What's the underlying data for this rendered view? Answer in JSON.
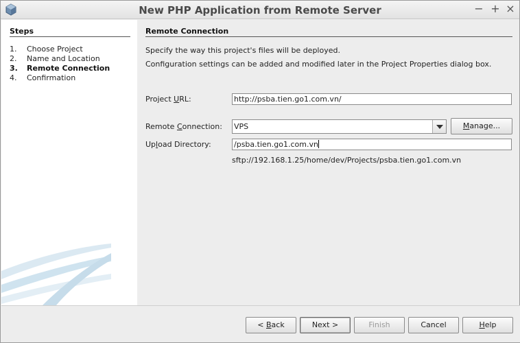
{
  "window": {
    "title": "New PHP Application from Remote Server",
    "minimize_glyph": "−",
    "maximize_glyph": "+",
    "close_glyph": "×"
  },
  "steps": {
    "title": "Steps",
    "items": [
      {
        "num": "1.",
        "label": "Choose Project",
        "current": false
      },
      {
        "num": "2.",
        "label": "Name and Location",
        "current": false
      },
      {
        "num": "3.",
        "label": "Remote Connection",
        "current": true
      },
      {
        "num": "4.",
        "label": "Confirmation",
        "current": false
      }
    ]
  },
  "panel": {
    "title": "Remote Connection",
    "description_1": "Specify the way this project's files will be deployed.",
    "description_2": "Configuration settings can be added and modified later in the Project Properties dialog box."
  },
  "form": {
    "project_url": {
      "label_pre": "Project ",
      "label_mn": "U",
      "label_post": "RL:",
      "value": "http://psba.tien.go1.com.vn/"
    },
    "remote_connection": {
      "label_pre": "Remote ",
      "label_mn": "C",
      "label_post": "onnection:",
      "value": "VPS"
    },
    "manage_button": {
      "label_pre": "",
      "label_mn": "M",
      "label_post": "anage..."
    },
    "upload_directory": {
      "label_pre": "Up",
      "label_mn": "l",
      "label_post": "oad Directory:",
      "value": "/psba.tien.go1.com.vn"
    },
    "remote_path_hint": "sftp://192.168.1.25/home/dev/Projects/psba.tien.go1.com.vn"
  },
  "buttons": {
    "back": {
      "pre": "< ",
      "mn": "B",
      "post": "ack"
    },
    "next": "Next >",
    "finish": "Finish",
    "cancel": "Cancel",
    "help": {
      "pre": "",
      "mn": "H",
      "post": "elp"
    }
  },
  "colors": {
    "steps_bg": "#ffffff",
    "window_bg": "#ededed",
    "swoosh": "#cfe3ef"
  }
}
